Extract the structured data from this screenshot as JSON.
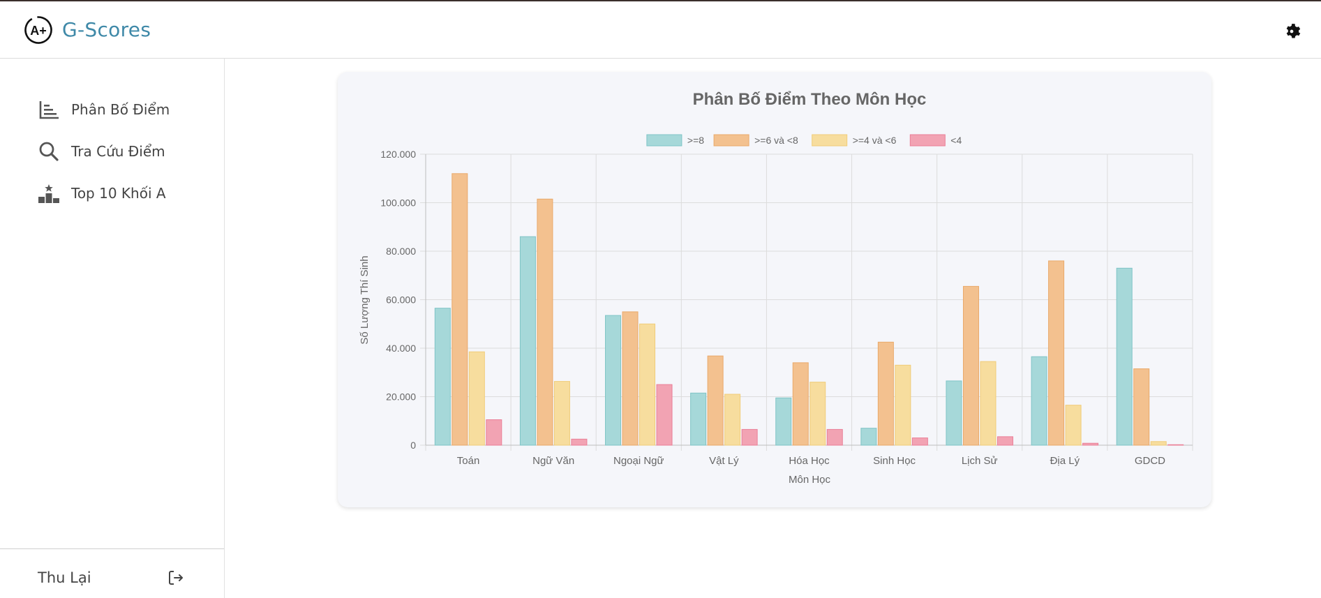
{
  "app": {
    "title": "G-Scores",
    "logo_text": "A+"
  },
  "sidebar": {
    "items": [
      {
        "label": "Phân Bố Điểm",
        "icon": "bar-chart-icon"
      },
      {
        "label": "Tra Cứu Điểm",
        "icon": "search-icon"
      },
      {
        "label": "Top 10 Khối A",
        "icon": "podium-icon"
      }
    ],
    "footer": {
      "label": "Thu Lại",
      "icon": "logout-icon"
    }
  },
  "header": {
    "theme_toggle_icon": "gear-icon"
  },
  "colors": {
    "brand": "#3f89a8",
    "series": [
      "#a6d8d9",
      "#f3c18f",
      "#f7dd9e",
      "#f2a3b3"
    ],
    "series_border": [
      "#7fc4c6",
      "#e9a96a",
      "#f0cc78",
      "#ea7f97"
    ]
  },
  "chart_data": {
    "type": "bar",
    "title": "Phân Bố Điểm Theo Môn Học",
    "xlabel": "Môn Học",
    "ylabel": "Số Lượng Thí Sinh",
    "categories": [
      "Toán",
      "Ngữ Văn",
      "Ngoại Ngữ",
      "Vật Lý",
      "Hóa Học",
      "Sinh Học",
      "Lịch Sử",
      "Địa Lý",
      "GDCD"
    ],
    "series": [
      {
        "name": ">=8",
        "values": [
          56500,
          86000,
          53500,
          21500,
          19500,
          7000,
          26500,
          36500,
          73000
        ]
      },
      {
        "name": ">=6 và <8",
        "values": [
          112000,
          101500,
          55000,
          36800,
          34000,
          42500,
          65500,
          76000,
          31500
        ]
      },
      {
        "name": ">=4 và <6",
        "values": [
          38500,
          26300,
          50000,
          21000,
          26000,
          33000,
          34500,
          16500,
          1500
        ]
      },
      {
        "name": "<4",
        "values": [
          10500,
          2500,
          25000,
          6500,
          6500,
          3000,
          3500,
          800,
          200
        ]
      }
    ],
    "ylim": [
      0,
      120000
    ],
    "yticks": [
      "0",
      "20.000",
      "40.000",
      "60.000",
      "80.000",
      "100.000",
      "120.000"
    ],
    "grid": true,
    "legend": "top"
  }
}
